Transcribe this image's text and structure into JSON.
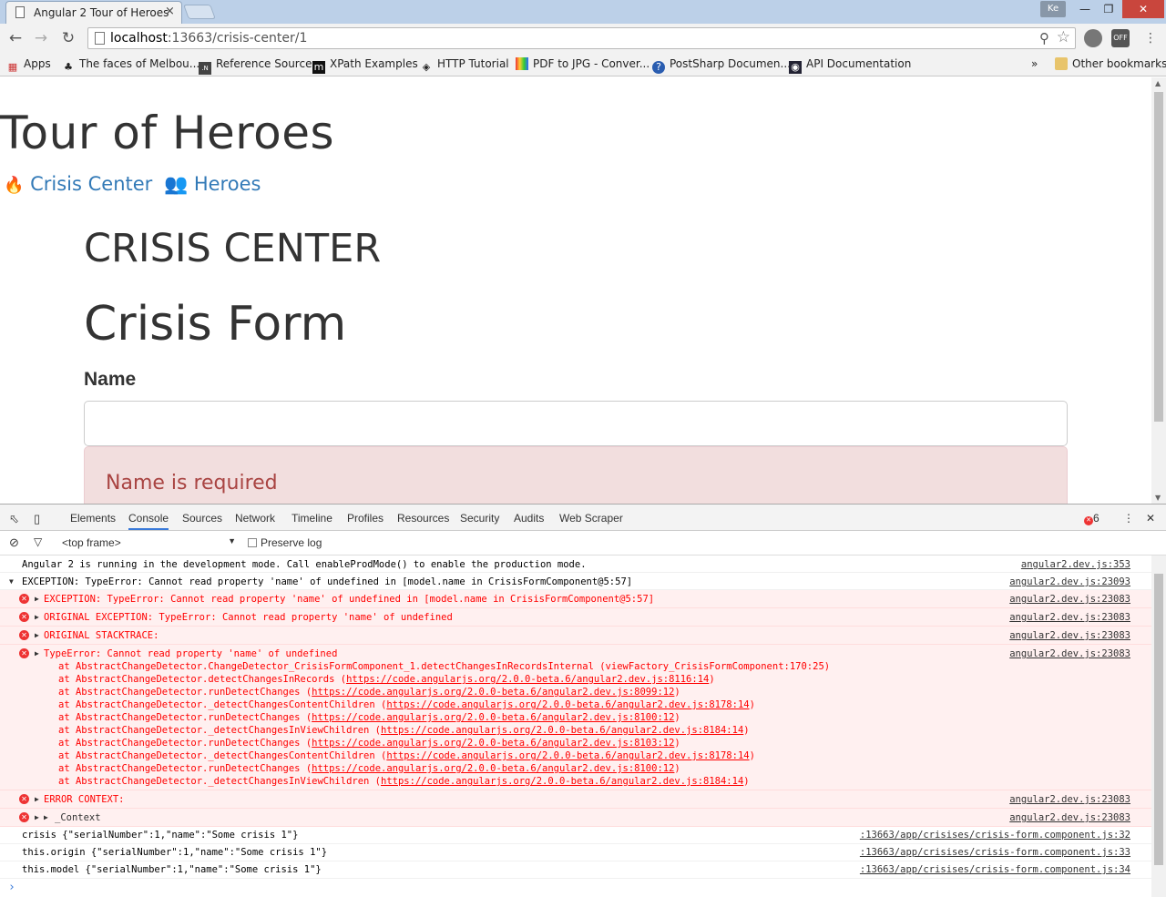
{
  "browser": {
    "tab_title": "Angular 2 Tour of Heroes",
    "tab_close": "×",
    "profile": "Ke",
    "url_host": "localhost",
    "url_rest": ":13663/crisis-center/1",
    "ext_label": "OFF"
  },
  "bookmarks": {
    "apps": "Apps",
    "items": [
      "The faces of Melbou...",
      "Reference Source",
      "XPath Examples",
      "HTTP Tutorial",
      "PDF to JPG - Conver...",
      "PostSharp Documen...",
      "API Documentation"
    ],
    "overflow": "»",
    "other": "Other bookmarks"
  },
  "page": {
    "app_title": "Tour of Heroes",
    "nav_crisis": "Crisis Center",
    "nav_heroes": "Heroes",
    "section_header": "CRISIS CENTER",
    "form_title": "Crisis Form",
    "name_label": "Name",
    "name_value": "",
    "alert_text": "Name is required"
  },
  "devtools": {
    "tabs": [
      "Elements",
      "Console",
      "Sources",
      "Network",
      "Timeline",
      "Profiles",
      "Resources",
      "Security",
      "Audits",
      "Web Scraper"
    ],
    "active_tab": "Console",
    "error_count": "6",
    "frame_select": "<top frame>",
    "preserve_log": "Preserve log",
    "console": {
      "info1": {
        "msg": "Angular 2 is running in the development mode. Call enableProdMode() to enable the production mode.",
        "src": "angular2.dev.js:353"
      },
      "group": {
        "msg": "EXCEPTION: TypeError: Cannot read property 'name' of undefined in [model.name in CrisisFormComponent@5:57]",
        "src": "angular2.dev.js:23093"
      },
      "e1": {
        "msg": "EXCEPTION: TypeError: Cannot read property 'name' of undefined in [model.name in CrisisFormComponent@5:57]",
        "src": "angular2.dev.js:23083"
      },
      "e2": {
        "msg": "ORIGINAL EXCEPTION: TypeError: Cannot read property 'name' of undefined",
        "src": "angular2.dev.js:23083"
      },
      "e3": {
        "msg": "ORIGINAL STACKTRACE:",
        "src": "angular2.dev.js:23083"
      },
      "e4": {
        "msg": "TypeError: Cannot read property 'name' of undefined",
        "src": "angular2.dev.js:23083"
      },
      "stack": [
        {
          "pre": "at AbstractChangeDetector.ChangeDetector_CrisisFormComponent_1.detectChangesInRecordsInternal (viewFactory_CrisisFormComponent:170:25)",
          "link": ""
        },
        {
          "pre": "at AbstractChangeDetector.detectChangesInRecords (",
          "link": "https://code.angularjs.org/2.0.0-beta.6/angular2.dev.js:8116:14",
          "post": ")"
        },
        {
          "pre": "at AbstractChangeDetector.runDetectChanges (",
          "link": "https://code.angularjs.org/2.0.0-beta.6/angular2.dev.js:8099:12",
          "post": ")"
        },
        {
          "pre": "at AbstractChangeDetector._detectChangesContentChildren (",
          "link": "https://code.angularjs.org/2.0.0-beta.6/angular2.dev.js:8178:14",
          "post": ")"
        },
        {
          "pre": "at AbstractChangeDetector.runDetectChanges (",
          "link": "https://code.angularjs.org/2.0.0-beta.6/angular2.dev.js:8100:12",
          "post": ")"
        },
        {
          "pre": "at AbstractChangeDetector._detectChangesInViewChildren (",
          "link": "https://code.angularjs.org/2.0.0-beta.6/angular2.dev.js:8184:14",
          "post": ")"
        },
        {
          "pre": "at AbstractChangeDetector.runDetectChanges (",
          "link": "https://code.angularjs.org/2.0.0-beta.6/angular2.dev.js:8103:12",
          "post": ")"
        },
        {
          "pre": "at AbstractChangeDetector._detectChangesContentChildren (",
          "link": "https://code.angularjs.org/2.0.0-beta.6/angular2.dev.js:8178:14",
          "post": ")"
        },
        {
          "pre": "at AbstractChangeDetector.runDetectChanges (",
          "link": "https://code.angularjs.org/2.0.0-beta.6/angular2.dev.js:8100:12",
          "post": ")"
        },
        {
          "pre": "at AbstractChangeDetector._detectChangesInViewChildren (",
          "link": "https://code.angularjs.org/2.0.0-beta.6/angular2.dev.js:8184:14",
          "post": ")"
        }
      ],
      "e5": {
        "msg": "ERROR CONTEXT:",
        "src": "angular2.dev.js:23083"
      },
      "e6": {
        "msg": "_Context",
        "src": "angular2.dev.js:23083"
      },
      "l1": {
        "msg": "crisis {\"serialNumber\":1,\"name\":\"Some crisis 1\"}",
        "src": ":13663/app/crisises/crisis-form.component.js:32"
      },
      "l2": {
        "msg": "this.origin {\"serialNumber\":1,\"name\":\"Some crisis 1\"}",
        "src": ":13663/app/crisises/crisis-form.component.js:33"
      },
      "l3": {
        "msg": "this.model {\"serialNumber\":1,\"name\":\"Some crisis 1\"}",
        "src": ":13663/app/crisises/crisis-form.component.js:34"
      },
      "prompt": "›"
    }
  }
}
